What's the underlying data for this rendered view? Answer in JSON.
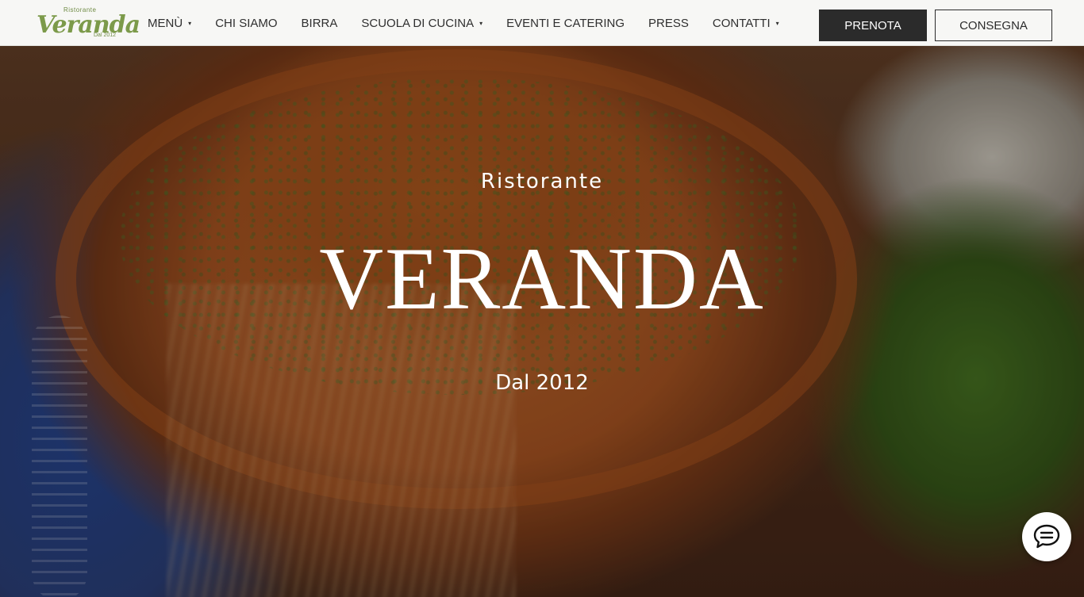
{
  "brand": {
    "logo_top": "Ristorante",
    "logo_word": "Veranda",
    "logo_bottom": "Dal 2012",
    "accent_color": "#7c9a4a"
  },
  "nav": {
    "items": [
      {
        "label": "MENÙ",
        "has_dropdown": true
      },
      {
        "label": "CHI SIAMO",
        "has_dropdown": false
      },
      {
        "label": "BIRRA",
        "has_dropdown": false
      },
      {
        "label": "SCUOLA DI CUCINA",
        "has_dropdown": true
      },
      {
        "label": "EVENTI E CATERING",
        "has_dropdown": false
      },
      {
        "label": "PRESS",
        "has_dropdown": false
      },
      {
        "label": "CONTATTI",
        "has_dropdown": true
      }
    ],
    "caret": "▾"
  },
  "actions": {
    "prenota": "PRENOTA",
    "consegna": "CONSEGNA"
  },
  "hero": {
    "subtitle": "Ristorante",
    "title": "VERANDA",
    "since": "Dal 2012"
  },
  "chat": {
    "icon": "chat-bubble-icon"
  }
}
